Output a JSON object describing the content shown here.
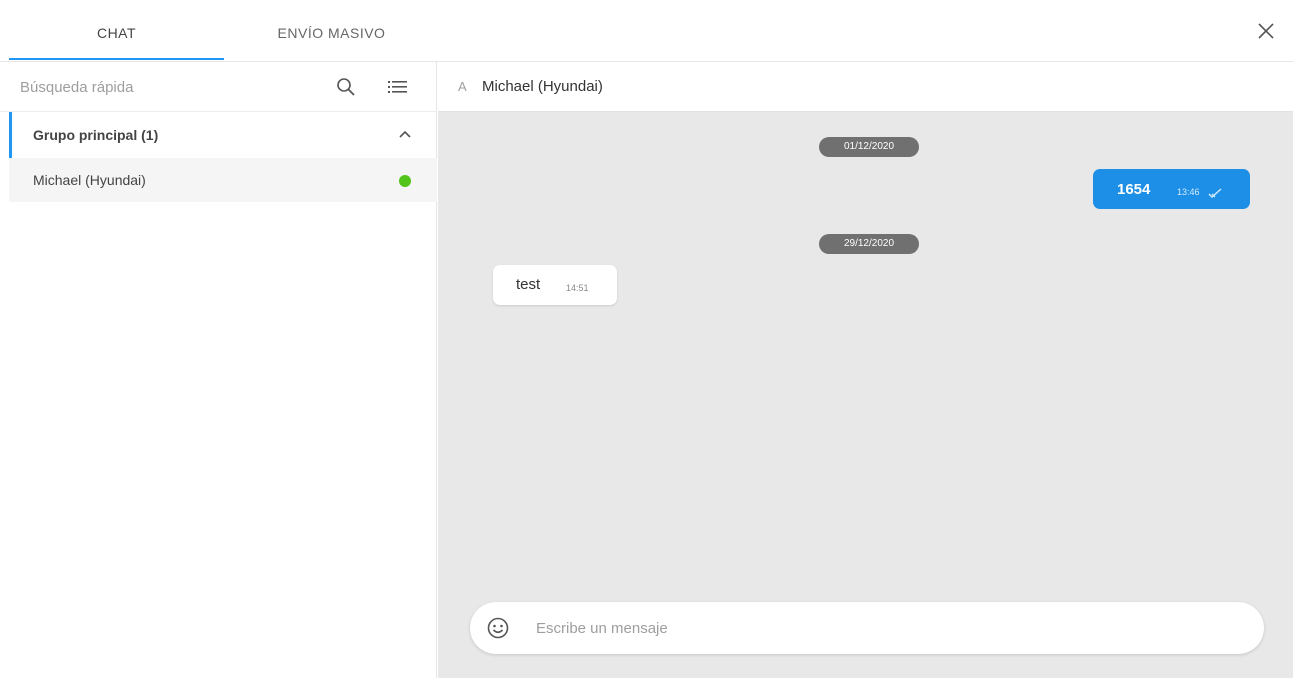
{
  "tabs": [
    {
      "label": "CHAT",
      "active": true
    },
    {
      "label": "ENVÍO MASIVO",
      "active": false
    }
  ],
  "close_icon": "close-icon",
  "sidebar": {
    "search": {
      "placeholder": "Búsqueda rápida",
      "value": ""
    },
    "search_icon": "search-icon",
    "list_icon": "list-icon",
    "group": {
      "label": "Grupo principal (1)",
      "expanded": true
    },
    "contacts": [
      {
        "name": "Michael (Hyundai)",
        "status": "online",
        "status_color": "#52c41a"
      }
    ]
  },
  "chat": {
    "header": {
      "prefix": "A",
      "name": "Michael (Hyundai)"
    },
    "messages": [
      {
        "type": "date",
        "text": "01/12/2020"
      },
      {
        "type": "outgoing",
        "text": "1654",
        "time": "13:46",
        "read": true
      },
      {
        "type": "date",
        "text": "29/12/2020"
      },
      {
        "type": "incoming",
        "text": "test",
        "time": "14:51"
      }
    ],
    "composer": {
      "placeholder": "Escribe un mensaje",
      "value": "",
      "emoji_icon": "smile-icon"
    }
  },
  "colors": {
    "accent": "#2196f3",
    "outgoing_bubble": "#1e8fe6",
    "chat_background": "#e8e8e8",
    "date_chip": "#707070",
    "online": "#52c41a"
  }
}
